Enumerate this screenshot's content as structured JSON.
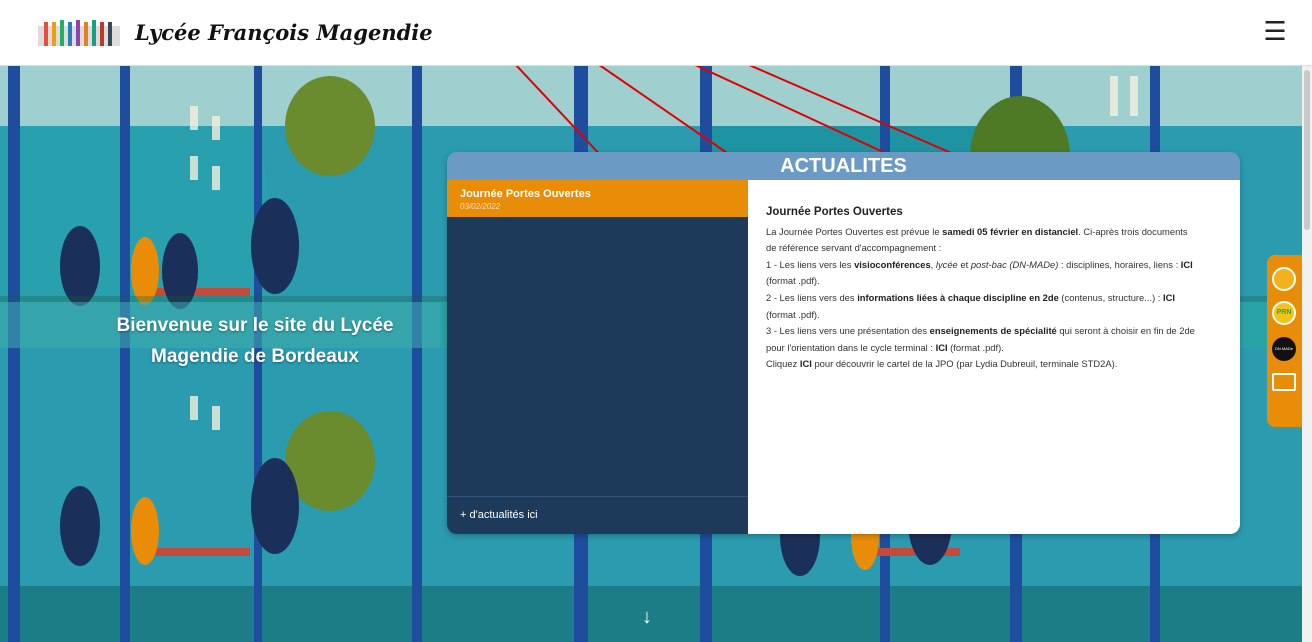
{
  "header": {
    "title": "Lycée François Magendie",
    "menu_icon": "hamburger-icon"
  },
  "hero": {
    "welcome": "Bienvenue sur le site du Lycée Magendie de Bordeaux"
  },
  "news": {
    "heading": "ACTUALITES",
    "item": {
      "title": "Journée Portes Ouvertes",
      "date": "03/02/2022"
    },
    "more_link": "+ d'actualités ici",
    "article": {
      "title": "Journée Portes Ouvertes",
      "intro_start": "La Journée Portes Ouvertes est prévue le ",
      "intro_bold": "samedi 05 février en distanciel",
      "intro_end": ". Ci-après trois documents",
      "intro_line2": "de référence servant d'accompagnement :",
      "p1_start": "1 - Les liens vers les ",
      "p1_bold": "visioconférences",
      "p1_mid1": ", ",
      "p1_it1": "lycée",
      "p1_mid2": " et ",
      "p1_it2": "post-bac (DN-MADe)",
      "p1_end": " : disciplines, horaires, liens : ",
      "p1_link": "ICI",
      "p1_format": "(format .pdf).",
      "p2_start": "2 - Les liens vers des ",
      "p2_bold": "informations liées à chaque discipline en 2de",
      "p2_end": " (contenus, structure...) : ",
      "p2_link": "ICI",
      "p2_format": "(format .pdf).",
      "p3_start": "3 - Les liens vers une présentation des ",
      "p3_bold": "enseignements de spécialité",
      "p3_end": " qui seront à choisir en fin de 2de",
      "p3_line2_start": "pour l'orientation dans le cycle terminal : ",
      "p3_link": "ICI",
      "p3_format": " (format .pdf).",
      "p4_start": "Cliquez ",
      "p4_link": "ICI",
      "p4_end": " pour découvrir le cartel de la JPO (par Lydia Dubreuil, terminale STD2A)."
    }
  },
  "side_icons": {
    "i2": "PRN",
    "i3": "DN MADe"
  },
  "colors": {
    "accent": "#e98d09",
    "news_blue": "#6b9ac4",
    "navy": "#1e3a5a",
    "annotation_red": "#e00000"
  }
}
